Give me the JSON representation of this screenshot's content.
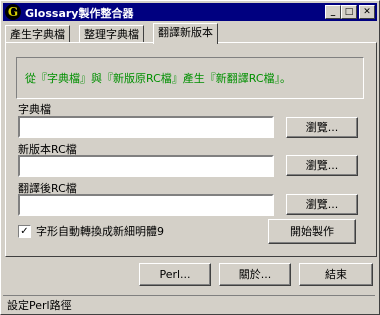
{
  "window": {
    "icon_letter": "G",
    "title": "Glossary製作整合器",
    "minimize_glyph": "_",
    "maximize_glyph": "□",
    "close_glyph": "✕"
  },
  "tabs": [
    {
      "label": "產生字典檔"
    },
    {
      "label": "整理字典檔"
    },
    {
      "label": "翻譯新版本"
    }
  ],
  "panel": {
    "info_text": "從『字典檔』與『新版原RC檔』產生『新翻譯RC檔』。",
    "dictionary": {
      "label": "字典檔",
      "value": "",
      "browse": "瀏覽..."
    },
    "new_rc": {
      "label": "新版本RC檔",
      "value": "",
      "browse": "瀏覽..."
    },
    "translated_rc": {
      "label": "翻譯後RC檔",
      "value": "",
      "browse": "瀏覽..."
    },
    "convert_checkbox": {
      "label": "字形自動轉換成新細明體9",
      "checked": true,
      "check_glyph": "✓"
    },
    "start_button": "開始製作"
  },
  "footer": {
    "perl_button": "Perl...",
    "about_button": "關於...",
    "exit_button": "結束"
  },
  "status_bar": {
    "text": "設定Perl路徑"
  }
}
